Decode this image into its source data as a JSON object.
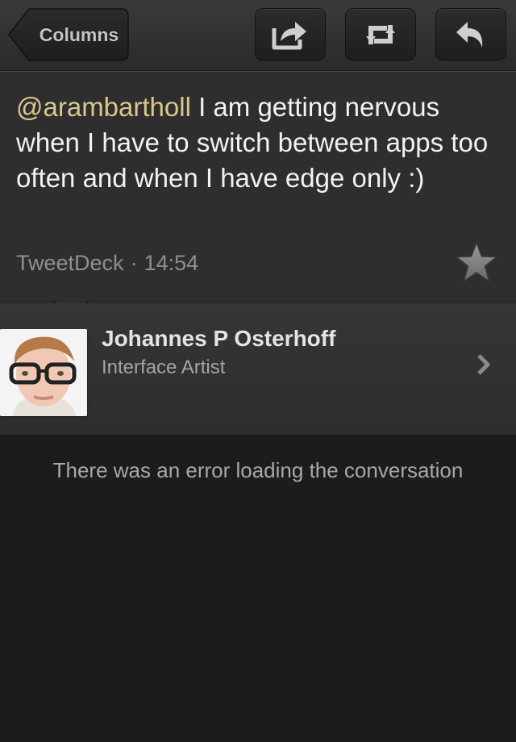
{
  "toolbar": {
    "back_label": "Columns",
    "share_icon": "share-icon",
    "retweet_icon": "retweet-icon",
    "reply_icon": "reply-icon"
  },
  "tweet": {
    "mention": "@arambartholl",
    "text": " I am getting nervous when I have to switch between apps too often and when I have edge only :)",
    "source": "TweetDeck",
    "separator": "·",
    "time": "14:54",
    "mention_color": "#d8c78e"
  },
  "profile": {
    "name": "Johannes P Osterhoff",
    "title": "Interface Artist"
  },
  "conversation": {
    "error": "There was an error loading the conversation"
  }
}
